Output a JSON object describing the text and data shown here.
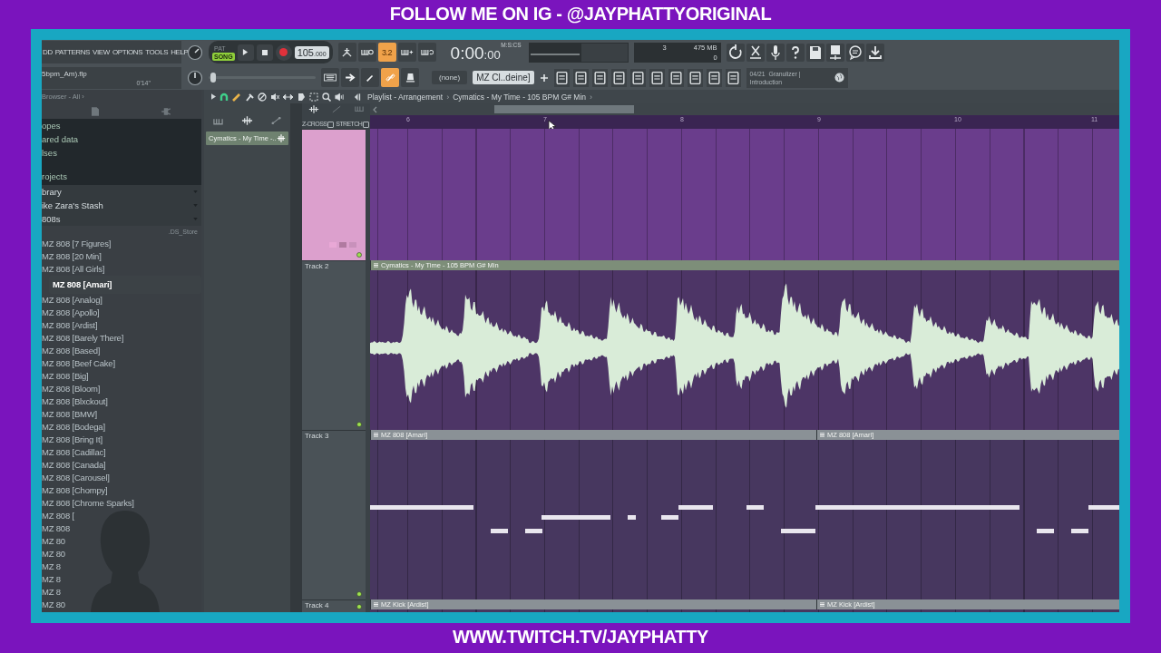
{
  "banner_top": "FOLLOW ME ON IG - @JAYPHATTYORIGINAL",
  "banner_bottom": "WWW.TWITCH.TV/JAYPHATTY",
  "menu": [
    "DD",
    "PATTERNS",
    "VIEW",
    "OPTIONS",
    "TOOLS",
    "HELP"
  ],
  "project": {
    "file": "5bpm_Am).flp",
    "time": "0'14\""
  },
  "transport": {
    "modes": [
      {
        "label": "PAT",
        "selected": false
      },
      {
        "label": "SONG",
        "selected": true
      }
    ],
    "tempo": "105",
    "tempo_decimals": ".000"
  },
  "toggles_1": [
    {
      "kind": "metronome",
      "on": false
    },
    {
      "kind": "wait",
      "on": false
    },
    {
      "kind": "countdown",
      "label": "3.2",
      "on": true
    },
    {
      "kind": "step",
      "on": false
    },
    {
      "kind": "loop",
      "on": false
    }
  ],
  "clock": {
    "value": "0:00",
    "centiseconds": ":00",
    "unit": "M:S:CS"
  },
  "monitor": {
    "voices": "3",
    "memory": "475 MB",
    "cpu": "0"
  },
  "master_slider": {
    "level": 0.04
  },
  "toggles_2": [
    {
      "kind": "keyboard",
      "on": false
    },
    {
      "kind": "arrow",
      "on": false
    },
    {
      "kind": "pen",
      "on": false
    },
    {
      "kind": "link",
      "on": true
    },
    {
      "kind": "cup",
      "on": false
    }
  ],
  "pattern": {
    "selector": "(none)",
    "name": "MZ Cl..deine]"
  },
  "hint": {
    "line_1": "04/21  Granulizer |",
    "line_2": "Introduction"
  },
  "browser": {
    "title": "Browser - All ›",
    "tree": [
      {
        "label": "opes"
      },
      {
        "label": "ared data"
      },
      {
        "label": "lses"
      },
      {
        "label": "rojects"
      }
    ],
    "library": [
      {
        "label": "brary"
      },
      {
        "label": "ike Zara's Stash"
      },
      {
        "label": "808s"
      }
    ],
    "folder_file": ".DS_Store",
    "files": [
      {
        "label": "MZ 808 [7 Figures]",
        "selected": false
      },
      {
        "label": "MZ 808 [20 Min]",
        "selected": false
      },
      {
        "label": "MZ 808 [All Girls]",
        "selected": false
      },
      {
        "label": "MZ 808 [Amari]",
        "selected": true
      },
      {
        "label": "MZ 808 [Analog]",
        "selected": false
      },
      {
        "label": "MZ 808 [Apollo]",
        "selected": false
      },
      {
        "label": "MZ 808 [Ardist]",
        "selected": false
      },
      {
        "label": "MZ 808 [Barely There]",
        "selected": false
      },
      {
        "label": "MZ 808 [Based]",
        "selected": false
      },
      {
        "label": "MZ 808 [Beef Cake]",
        "selected": false
      },
      {
        "label": "MZ 808 [Big]",
        "selected": false
      },
      {
        "label": "MZ 808 [Bloom]",
        "selected": false
      },
      {
        "label": "MZ 808 [Blxckout]",
        "selected": false
      },
      {
        "label": "MZ 808 [BMW]",
        "selected": false
      },
      {
        "label": "MZ 808 [Bodega]",
        "selected": false
      },
      {
        "label": "MZ 808 [Bring It]",
        "selected": false
      },
      {
        "label": "MZ 808 [Cadillac]",
        "selected": false
      },
      {
        "label": "MZ 808 [Canada]",
        "selected": false
      },
      {
        "label": "MZ 808 [Carousel]",
        "selected": false
      },
      {
        "label": "MZ 808 [Chompy]",
        "selected": false
      },
      {
        "label": "MZ 808 [Chrome Sparks]",
        "selected": false
      },
      {
        "label": "MZ 808 [",
        "selected": false
      },
      {
        "label": "MZ 808",
        "selected": false
      },
      {
        "label": "MZ 80",
        "selected": false
      },
      {
        "label": "MZ 80",
        "selected": false
      },
      {
        "label": "MZ 8",
        "selected": false
      },
      {
        "label": "MZ 8",
        "selected": false
      },
      {
        "label": "MZ 8",
        "selected": false
      },
      {
        "label": "MZ 80",
        "selected": false
      }
    ]
  },
  "playlist": {
    "title": "Playlist - Arrangement",
    "pattern": "Cymatics - My Time - 105 BPM G# Min",
    "separators": [
      "›",
      "›"
    ],
    "picker_clip": "Cymatics - My Time -..",
    "options": [
      {
        "label": "Z-CROSS",
        "checked": false
      },
      {
        "label": "STRETCH",
        "checked": false
      }
    ],
    "ruler": [
      "6",
      "7",
      "8",
      "9",
      "10",
      "11"
    ],
    "tracks": [
      {
        "kind": "filled",
        "selected": true
      },
      {
        "name": "Track 2",
        "kind": "audio",
        "selected": false,
        "clips": [
          {
            "label": "Cymatics - My Time - 105 BPM G# Min"
          }
        ]
      },
      {
        "name": "Track 3",
        "kind": "pattern",
        "selected": false,
        "clips": [
          {
            "label": "MZ 808 [Amari]"
          },
          {
            "label": "MZ 808 [Amari]"
          }
        ]
      },
      {
        "name": "Track 4",
        "kind": "pattern",
        "selected": false,
        "clips": [
          {
            "label": "MZ Kick [Ardist]"
          },
          {
            "label": "MZ Kick [Ardist]"
          }
        ]
      }
    ]
  }
}
